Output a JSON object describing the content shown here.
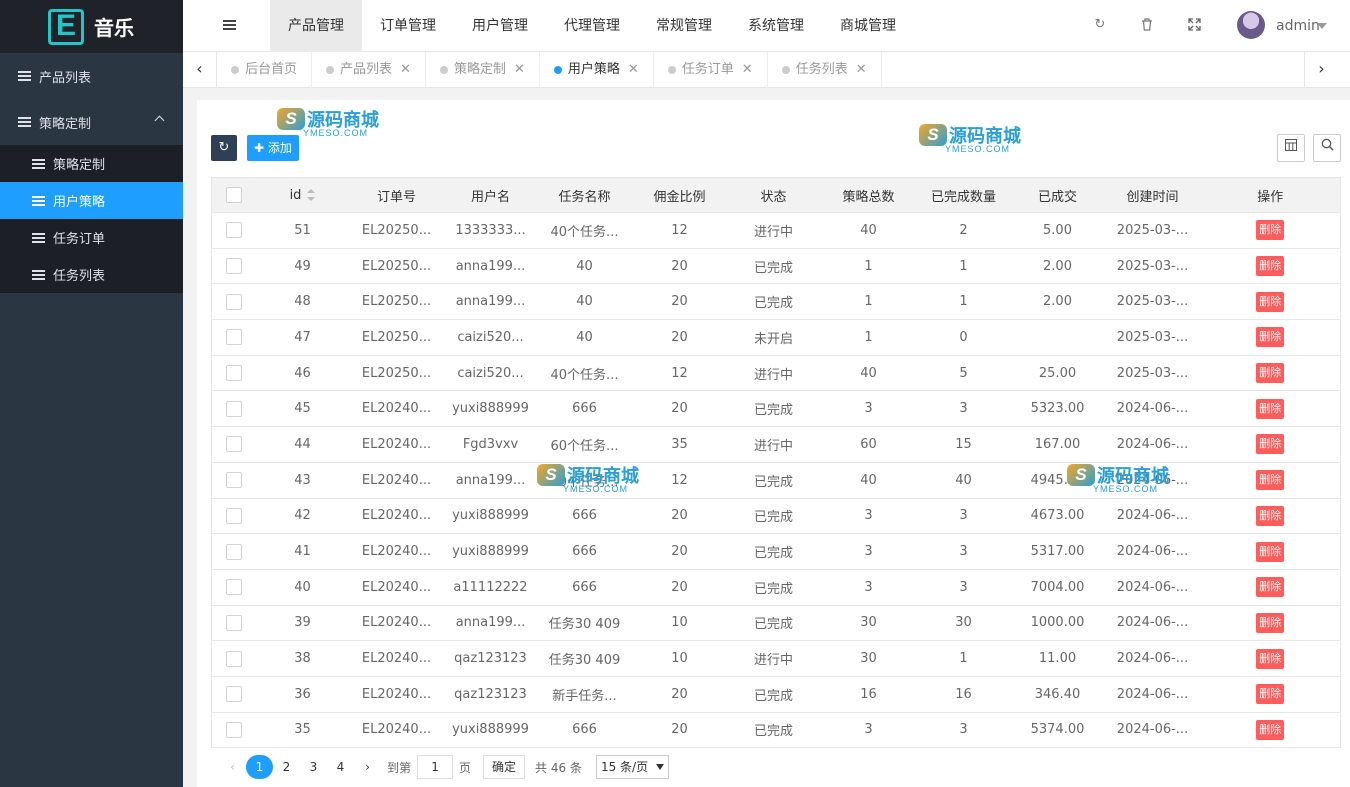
{
  "sidebar": {
    "logo_letter": "E",
    "logo_text": "音乐",
    "items": [
      {
        "label": "产品列表"
      },
      {
        "label": "策略定制"
      }
    ],
    "sub_items": [
      {
        "label": "策略定制"
      },
      {
        "label": "用户策略"
      },
      {
        "label": "任务订单"
      },
      {
        "label": "任务列表"
      }
    ]
  },
  "header": {
    "nav": [
      "产品管理",
      "订单管理",
      "用户管理",
      "代理管理",
      "常规管理",
      "系统管理",
      "商城管理"
    ],
    "user": "admin"
  },
  "tabs": [
    "后台首页",
    "产品列表",
    "策略定制",
    "用户策略",
    "任务订单",
    "任务列表"
  ],
  "toolbar": {
    "add_label": "添加"
  },
  "watermark": {
    "text": "源码商城",
    "sub": "YMESO.COM"
  },
  "table": {
    "columns": [
      "id",
      "订单号",
      "用户名",
      "任务名称",
      "佣金比例",
      "状态",
      "策略总数",
      "已完成数量",
      "已成交",
      "创建时间",
      "操作"
    ],
    "rows": [
      [
        "51",
        "EL20250...",
        "1333333...",
        "40个任务...",
        "12",
        "进行中",
        "40",
        "2",
        "5.00",
        "2025-03-..."
      ],
      [
        "49",
        "EL20250...",
        "anna199...",
        "40",
        "20",
        "已完成",
        "1",
        "1",
        "2.00",
        "2025-03-..."
      ],
      [
        "48",
        "EL20250...",
        "anna199...",
        "40",
        "20",
        "已完成",
        "1",
        "1",
        "2.00",
        "2025-03-..."
      ],
      [
        "47",
        "EL20250...",
        "caizi520...",
        "40",
        "20",
        "未开启",
        "1",
        "0",
        "",
        "2025-03-..."
      ],
      [
        "46",
        "EL20250...",
        "caizi520...",
        "40个任务...",
        "12",
        "进行中",
        "40",
        "5",
        "25.00",
        "2025-03-..."
      ],
      [
        "45",
        "EL20240...",
        "yuxi888999",
        "666",
        "20",
        "已完成",
        "3",
        "3",
        "5323.00",
        "2024-06-..."
      ],
      [
        "44",
        "EL20240...",
        "Fgd3vxv",
        "60个任务...",
        "35",
        "进行中",
        "60",
        "15",
        "167.00",
        "2024-06-..."
      ],
      [
        "43",
        "EL20240...",
        "anna199...",
        "40个任务...",
        "12",
        "已完成",
        "40",
        "40",
        "4945.00",
        "2024-06-..."
      ],
      [
        "42",
        "EL20240...",
        "yuxi888999",
        "666",
        "20",
        "已完成",
        "3",
        "3",
        "4673.00",
        "2024-06-..."
      ],
      [
        "41",
        "EL20240...",
        "yuxi888999",
        "666",
        "20",
        "已完成",
        "3",
        "3",
        "5317.00",
        "2024-06-..."
      ],
      [
        "40",
        "EL20240...",
        "a11112222",
        "666",
        "20",
        "已完成",
        "3",
        "3",
        "7004.00",
        "2024-06-..."
      ],
      [
        "39",
        "EL20240...",
        "anna199...",
        "任务30 409",
        "10",
        "已完成",
        "30",
        "30",
        "1000.00",
        "2024-06-..."
      ],
      [
        "38",
        "EL20240...",
        "qaz123123",
        "任务30 409",
        "10",
        "进行中",
        "30",
        "1",
        "11.00",
        "2024-06-..."
      ],
      [
        "36",
        "EL20240...",
        "qaz123123",
        "新手任务...",
        "20",
        "已完成",
        "16",
        "16",
        "346.40",
        "2024-06-..."
      ],
      [
        "35",
        "EL20240...",
        "yuxi888999",
        "666",
        "20",
        "已完成",
        "3",
        "3",
        "5374.00",
        "2024-06-..."
      ]
    ],
    "delete_label": "删除"
  },
  "pager": {
    "pages": [
      "1",
      "2",
      "3",
      "4"
    ],
    "current": "1",
    "goto_label": "到第",
    "goto_value": "1",
    "page_unit": "页",
    "confirm": "确定",
    "total": "共 46 条",
    "per_page": "15 条/页"
  },
  "colors": {
    "accent": "#1e9fff",
    "sidebar": "#2b3643",
    "danger": "#ff5c5c"
  }
}
